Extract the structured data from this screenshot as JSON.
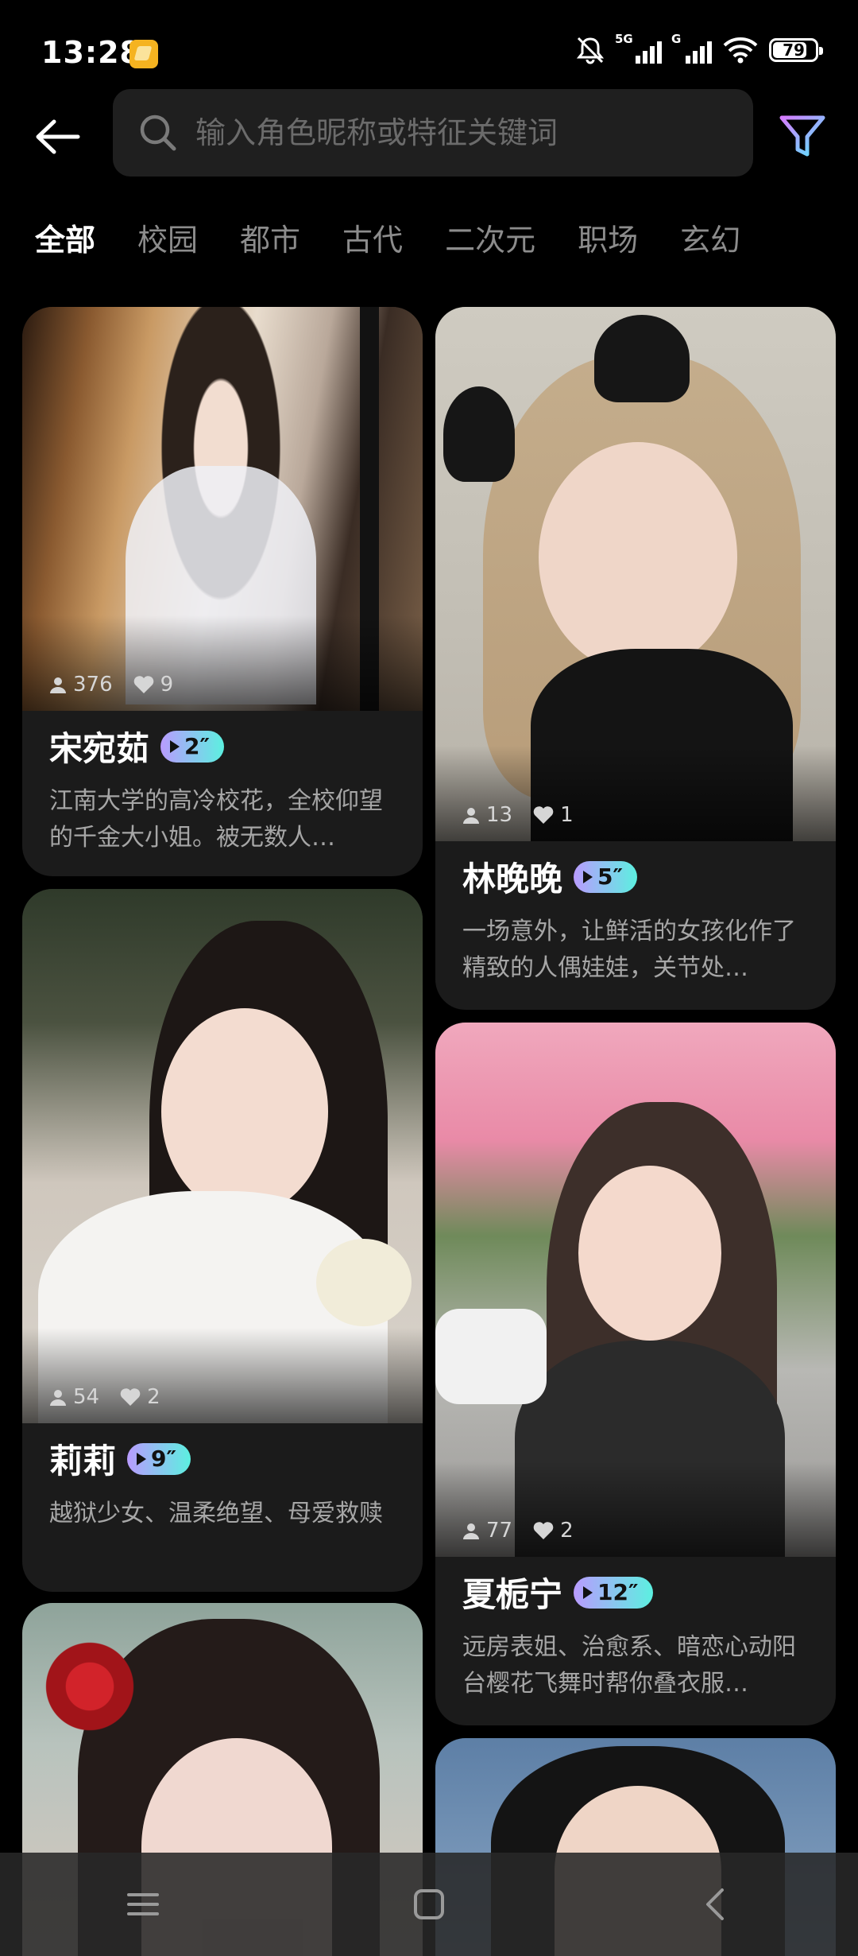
{
  "status_bar": {
    "time": "13:28",
    "net1": "5G",
    "net2": "G",
    "battery": "79"
  },
  "search": {
    "placeholder": "输入角色昵称或特征关键词"
  },
  "tabs": [
    {
      "label": "全部",
      "active": true
    },
    {
      "label": "校园"
    },
    {
      "label": "都市"
    },
    {
      "label": "古代"
    },
    {
      "label": "二次元"
    },
    {
      "label": "职场"
    },
    {
      "label": "玄幻"
    }
  ],
  "cards": [
    {
      "name": "宋宛茹",
      "duration": "2″",
      "users": "376",
      "likes": "9",
      "desc": "江南大学的高冷校花，全校仰望的千金大小姐。被无数人…"
    },
    {
      "name": "林晚晚",
      "duration": "5″",
      "users": "13",
      "likes": "1",
      "desc": "一场意外，让鲜活的女孩化作了精致的人偶娃娃，关节处…"
    },
    {
      "name": "莉莉",
      "duration": "9″",
      "users": "54",
      "likes": "2",
      "desc": "越狱少女、温柔绝望、母爱救赎"
    },
    {
      "name": "夏栀宁",
      "duration": "12″",
      "users": "77",
      "likes": "2",
      "desc": "远房表姐、治愈系、暗恋心动阳台樱花飞舞时帮你叠衣服…"
    }
  ],
  "colors": {
    "badge_start": "#b99bff",
    "badge_end": "#5cf0e0",
    "filter_icon_start": "#d67cff",
    "filter_icon_end": "#59e6ff"
  }
}
